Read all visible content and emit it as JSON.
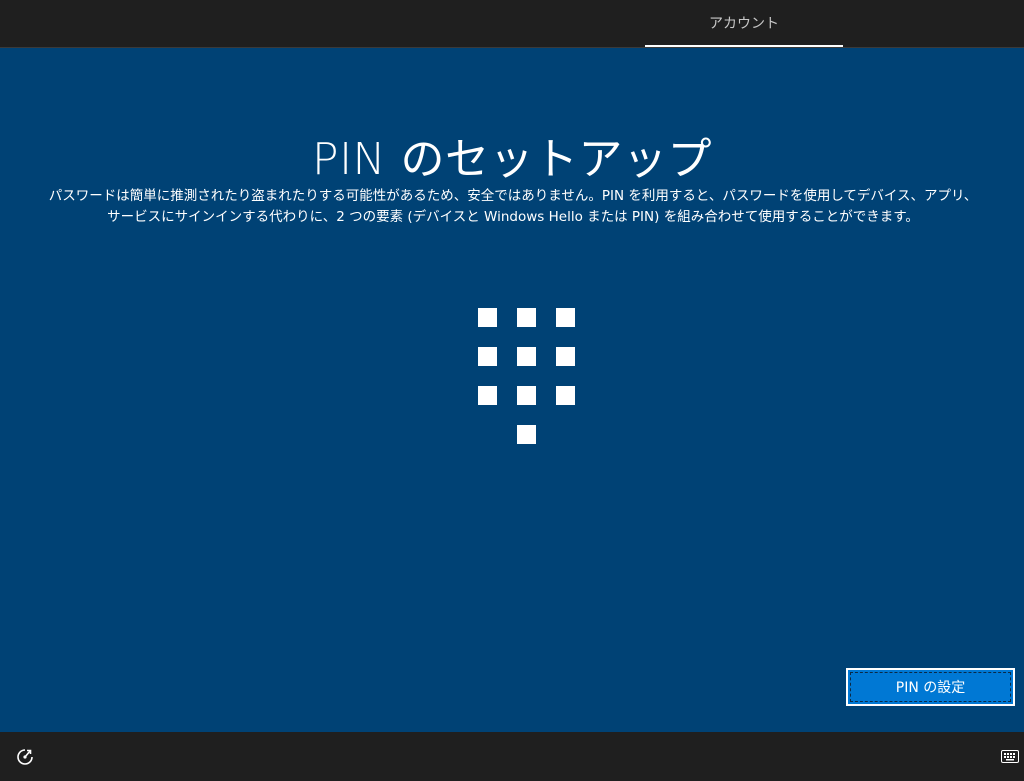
{
  "header": {
    "active_tab": "アカウント"
  },
  "main": {
    "title": "PIN のセットアップ",
    "description": "パスワードは簡単に推測されたり盗まれたりする可能性があるため、安全ではありません。PIN を利用すると、パスワードを使用してデバイス、アプリ、サービスにサインインする代わりに、2 つの要素 (デバイスと Windows Hello または PIN) を組み合わせて使用することができます。",
    "primary_button": "PIN の設定"
  },
  "footer": {
    "ease_of_access_icon": "ease-of-access-icon",
    "keyboard_icon": "keyboard-icon"
  },
  "colors": {
    "background": "#004275",
    "accent": "#0078d4",
    "chrome": "#1f1f1f"
  }
}
